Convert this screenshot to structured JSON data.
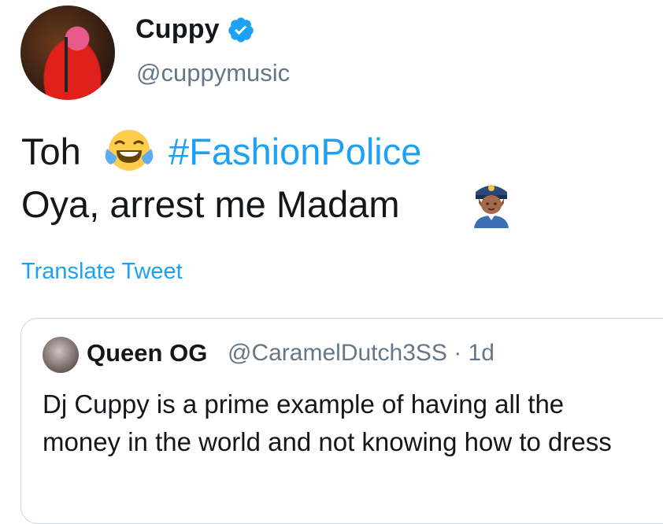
{
  "tweet": {
    "author_name": "Cuppy",
    "author_handle": "@cuppymusic",
    "verified": true,
    "line1_text": "Toh",
    "hashtag": "#FashionPolice",
    "line2_text": "Oya, arrest me Madam",
    "emojis": [
      "face-with-tears-of-joy-icon",
      "woman-police-officer-icon"
    ],
    "translate_label": "Translate Tweet"
  },
  "quoted_tweet": {
    "author_name": "Queen OG",
    "meta": "@CaramelDutch3SS · 1d",
    "text": "Dj Cuppy is a prime example of having all the money in the world and not knowing how to dress"
  },
  "colors": {
    "accent": "#1da1f2",
    "secondary_text": "#657786",
    "border": "#ccd6dd"
  }
}
